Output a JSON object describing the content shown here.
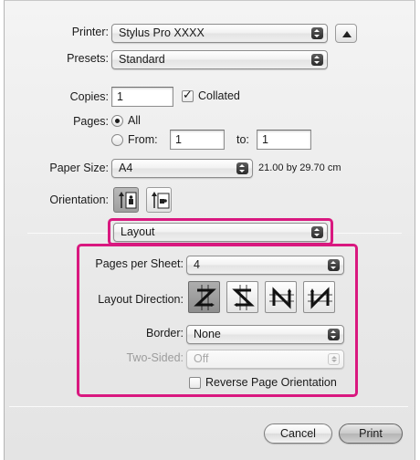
{
  "printer": {
    "label": "Printer:",
    "value": "Stylus Pro XXXX"
  },
  "presets": {
    "label": "Presets:",
    "value": "Standard"
  },
  "copies": {
    "label": "Copies:",
    "value": "1",
    "collated_label": "Collated",
    "collated_checked": true
  },
  "pages": {
    "label": "Pages:",
    "all_label": "All",
    "from_label": "From:",
    "from_value": "1",
    "to_label": "to:",
    "to_value": "1",
    "selected": "All"
  },
  "paper_size": {
    "label": "Paper Size:",
    "value": "A4",
    "dimensions": "21.00 by 29.70 cm"
  },
  "orientation": {
    "label": "Orientation:",
    "options": [
      "portrait-icon",
      "landscape-icon"
    ],
    "selected": "portrait"
  },
  "panel_select": {
    "value": "Layout"
  },
  "layout": {
    "pages_per_sheet_label": "Pages per Sheet:",
    "pages_per_sheet_value": "4",
    "layout_direction_label": "Layout Direction:",
    "directions": [
      "z-icon",
      "reverse-s-icon",
      "n-icon",
      "reverse-n-icon"
    ],
    "selected_direction": "z-icon",
    "border_label": "Border:",
    "border_value": "None",
    "two_sided_label": "Two-Sided:",
    "two_sided_value": "Off",
    "reverse_label": "Reverse Page Orientation",
    "reverse_checked": false
  },
  "buttons": {
    "cancel": "Cancel",
    "print": "Print"
  },
  "colors": {
    "highlight": "#d9187f"
  }
}
